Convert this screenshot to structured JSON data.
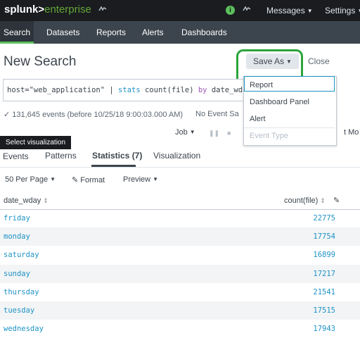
{
  "topbar": {
    "logo_main": "splunk>",
    "logo_sub": "enterprise",
    "info_badge": "i",
    "messages_label": "Messages",
    "settings_label": "Settings"
  },
  "appbar": {
    "tabs": [
      "Search",
      "Datasets",
      "Reports",
      "Alerts",
      "Dashboards"
    ],
    "accent": "#5cc05c"
  },
  "page": {
    "title": "New Search",
    "save_as": "Save As",
    "close": "Close",
    "highlight_color": "#2ca53a"
  },
  "search": {
    "parts": [
      "host=\"web_application\"",
      " | ",
      "stats",
      " count(file) ",
      "by",
      " date_wday"
    ]
  },
  "save_menu": {
    "items": [
      "Report",
      "Dashboard Panel",
      "Alert",
      "Event Type"
    ]
  },
  "status": {
    "events": "✓ 131,645 events (before 10/25/18 9:00:03.000 AM)",
    "no_event_sampling": "No Event Sa",
    "job": "Job",
    "more": "t Mo"
  },
  "tooltip": "Select visualization",
  "subtabs": [
    "Events",
    "Patterns",
    "Statistics (7)",
    "Visualization"
  ],
  "toolbar": {
    "per_page": "50 Per Page",
    "format": "Format",
    "preview": "Preview"
  },
  "table": {
    "columns": [
      "date_wday",
      "count(file)"
    ],
    "rows": [
      {
        "day": "friday",
        "count": "22775"
      },
      {
        "day": "monday",
        "count": "17754"
      },
      {
        "day": "saturday",
        "count": "16899"
      },
      {
        "day": "sunday",
        "count": "17217"
      },
      {
        "day": "thursday",
        "count": "21541"
      },
      {
        "day": "tuesday",
        "count": "17515"
      },
      {
        "day": "wednesday",
        "count": "17943"
      }
    ]
  }
}
